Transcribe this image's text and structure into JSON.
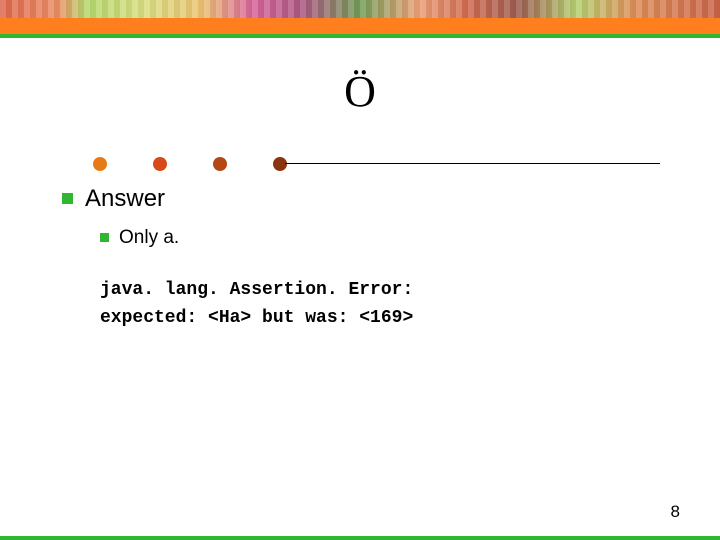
{
  "colors": {
    "orange": "#ff7f1f",
    "green": "#2fb82f",
    "dot1": "#e67a17",
    "dot2": "#d84a1a",
    "dot3": "#b44815",
    "dot4": "#8a3410"
  },
  "title": "Ö",
  "main_bullet": "Answer",
  "sub_bullet": "Only a.",
  "code_lines": [
    "java. lang. Assertion. Error:",
    "expected: <Ha> but was: <169>"
  ],
  "page_number": "8"
}
